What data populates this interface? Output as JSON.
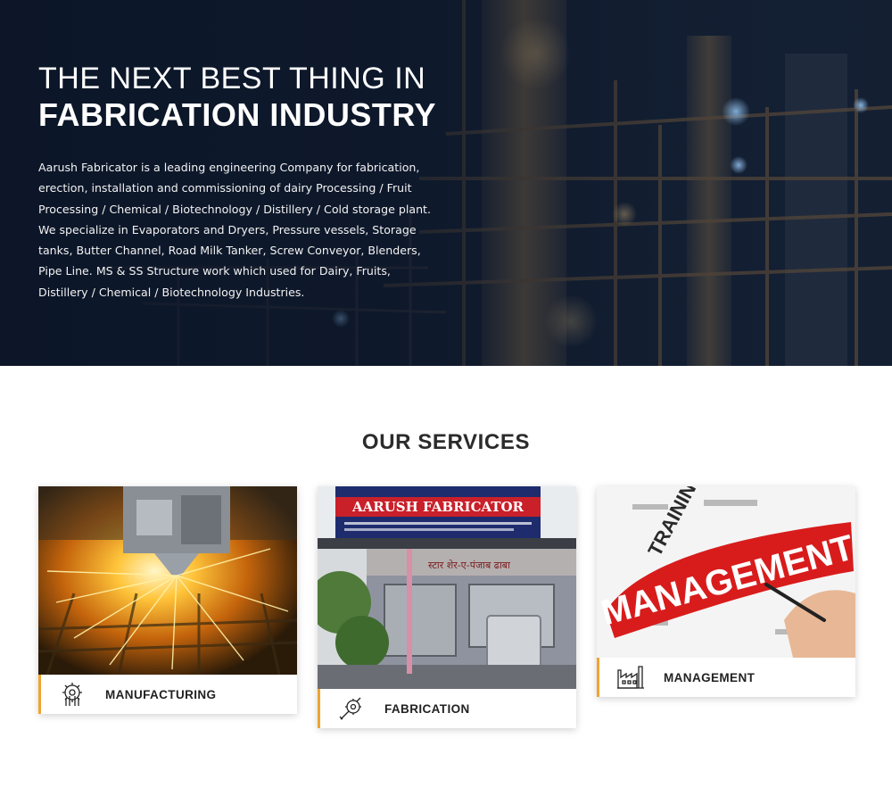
{
  "hero": {
    "line1": "THE NEXT BEST THING IN",
    "line2": "FABRICATION INDUSTRY",
    "description": "Aarush Fabricator is a leading engineering Company for fabrication, erection, installation and commissioning of dairy Processing / Fruit Processing / Chemical / Biotechnology / Distillery / Cold storage plant. We specialize in Evaporators and Dryers, Pressure vessels, Storage tanks, Butter Channel, Road Milk Tanker, Screw Conveyor, Blenders, Pipe Line. MS & SS Structure work which used for Dairy, Fruits, Distillery / Chemical / Biotechnology Industries."
  },
  "services": {
    "title": "OUR SERVICES",
    "cards": [
      {
        "label": "MANUFACTURING",
        "icon": "gear-hand-icon"
      },
      {
        "label": "FABRICATION",
        "icon": "wrench-gear-icon"
      },
      {
        "label": "MANAGEMENT",
        "icon": "factory-icon"
      }
    ],
    "fabrication_sign": {
      "title": "AARUSH FABRICATOR",
      "subtitle": "स्टार शेर-ए-पंजाब ढाबा"
    },
    "management_words": {
      "headline": "MANAGEMENT",
      "training": "TRAINING"
    }
  },
  "colors": {
    "accent": "#f0a430",
    "hero_bg": "#0e1a2e",
    "management_red": "#d81c1c"
  }
}
